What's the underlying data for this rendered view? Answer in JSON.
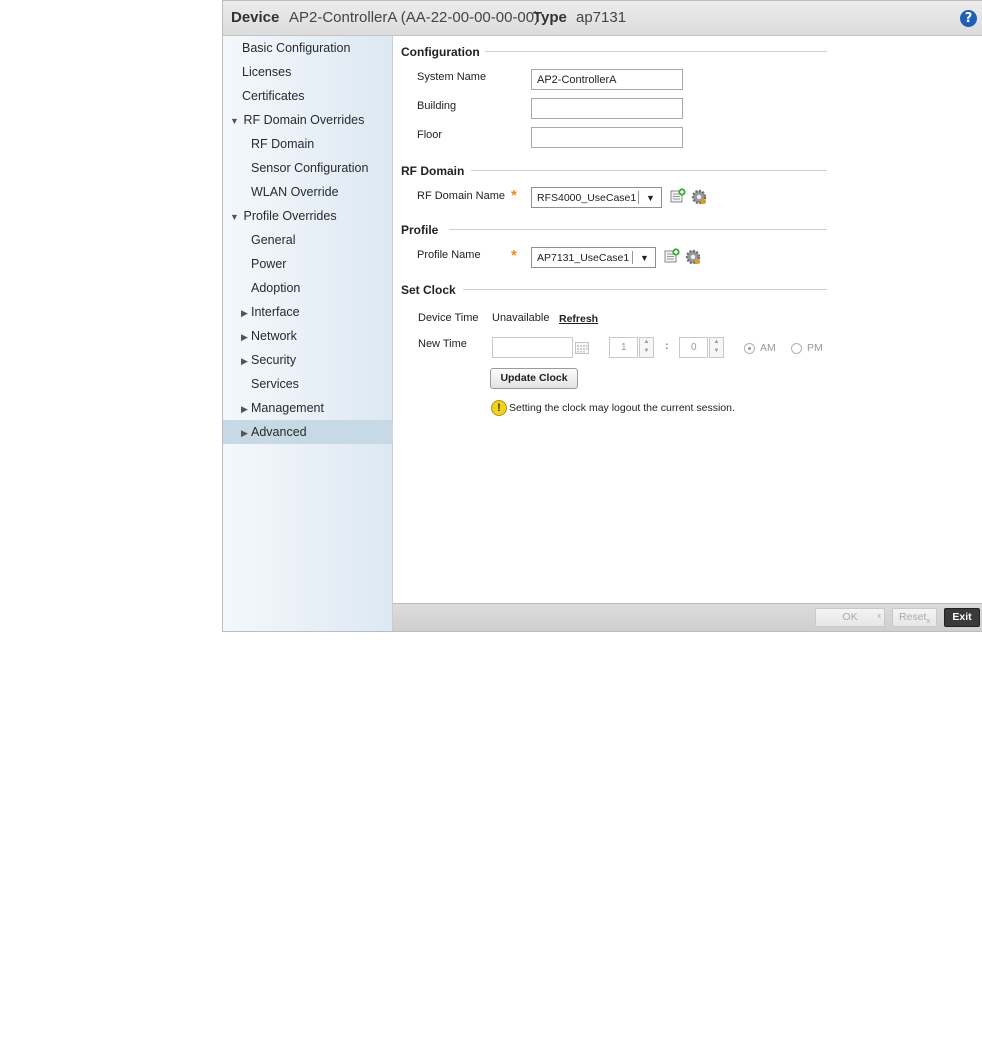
{
  "title": {
    "device_label": "Device",
    "device_value": "AP2-ControllerA (AA-22-00-00-00-00)",
    "type_label": "Type",
    "type_value": "ap7131",
    "help_icon": "?"
  },
  "sidebar": {
    "items": [
      {
        "label": "Basic Configuration"
      },
      {
        "label": "Licenses"
      },
      {
        "label": "Certificates"
      },
      {
        "label": "RF Domain Overrides",
        "arrow": "▼"
      },
      {
        "label": "RF Domain"
      },
      {
        "label": "Sensor Configuration"
      },
      {
        "label": "WLAN Override"
      },
      {
        "label": "Profile Overrides",
        "arrow": "▼"
      },
      {
        "label": "General"
      },
      {
        "label": "Power"
      },
      {
        "label": "Adoption"
      },
      {
        "label": "Interface",
        "arrow": "▶"
      },
      {
        "label": "Network",
        "arrow": "▶"
      },
      {
        "label": "Security",
        "arrow": "▶"
      },
      {
        "label": "Services"
      },
      {
        "label": "Management",
        "arrow": "▶"
      },
      {
        "label": "Advanced",
        "arrow": "▶",
        "selected": true
      }
    ]
  },
  "configuration": {
    "title": "Configuration",
    "system_name_label": "System Name",
    "system_name_value": "AP2-ControllerA",
    "building_label": "Building",
    "building_value": "",
    "floor_label": "Floor",
    "floor_value": ""
  },
  "rf_domain": {
    "title": "RF Domain",
    "name_label": "RF Domain Name",
    "required_mark": "*",
    "selected": "RFS4000_UseCase1"
  },
  "profile": {
    "title": "Profile",
    "name_label": "Profile Name",
    "required_mark": "*",
    "selected": "AP7131_UseCase1"
  },
  "set_clock": {
    "title": "Set Clock",
    "device_time_label": "Device Time",
    "device_time_value": "Unavailable",
    "refresh_label": "Refresh",
    "new_time_label": "New Time",
    "date_value": "",
    "hour_value": "1",
    "colon": ":",
    "minute_value": "0",
    "am_label": "AM",
    "pm_label": "PM",
    "update_button": "Update Clock",
    "warning_mark": "!",
    "warning_text": "Setting the clock may logout the current session."
  },
  "footer": {
    "ok_label": "OK",
    "ok_sub": "x",
    "reset_label": "Reset",
    "reset_sub": "x",
    "exit_label": "Exit"
  },
  "colors": {
    "accent_blue": "#1f5fb5",
    "required_orange": "#f08a1c",
    "warning_yellow": "#f1d21b",
    "selected_nav": "#c8d9e6",
    "exit_button": "#3a3a3a"
  }
}
